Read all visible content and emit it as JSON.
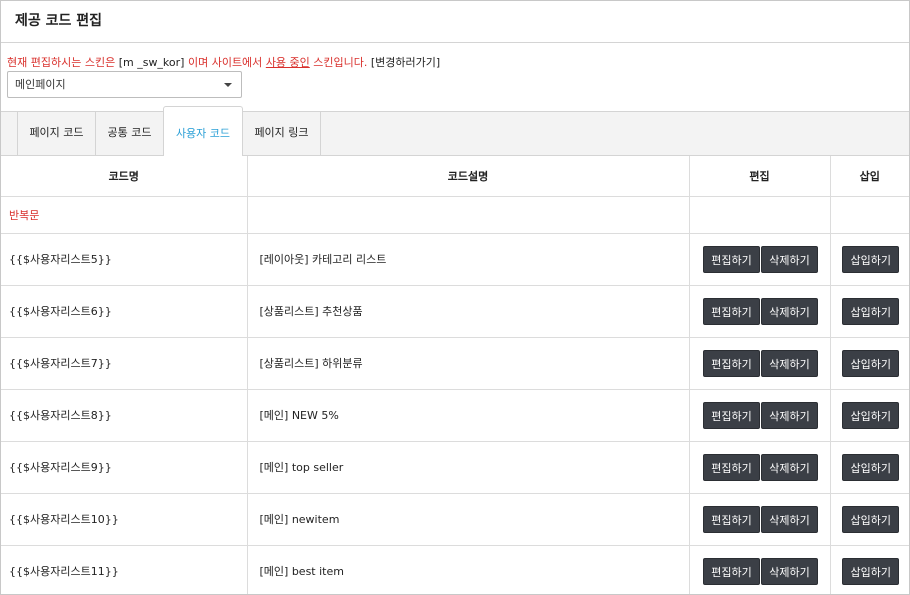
{
  "page": {
    "title": "제공 코드 편집"
  },
  "notice": {
    "prefix": "현재 편집하시는 스킨은 ",
    "skin": "[m _sw_kor]",
    "middle": " 이며 사이트에서 ",
    "link": "사용 중인",
    "suffix": " 스킨입니다. ",
    "change": "[변경하러가기]"
  },
  "selector": {
    "value": "메인페이지"
  },
  "tabs": [
    {
      "label": "페이지 코드",
      "active": false
    },
    {
      "label": "공통 코드",
      "active": false
    },
    {
      "label": "사용자 코드",
      "active": true
    },
    {
      "label": "페이지 링크",
      "active": false
    }
  ],
  "table": {
    "headers": {
      "name": "코드명",
      "desc": "코드설명",
      "edit": "편집",
      "insert": "삽입"
    },
    "group_label": "반복문",
    "buttons": {
      "edit": "편집하기",
      "delete": "삭제하기",
      "insert": "삽입하기"
    },
    "rows": [
      {
        "name": "{{$사용자리스트5}}",
        "desc": "[레이아웃] 카테고리 리스트"
      },
      {
        "name": "{{$사용자리스트6}}",
        "desc": "[상품리스트] 추천상품"
      },
      {
        "name": "{{$사용자리스트7}}",
        "desc": "[상품리스트] 하위분류"
      },
      {
        "name": "{{$사용자리스트8}}",
        "desc": "[메인] NEW 5%"
      },
      {
        "name": "{{$사용자리스트9}}",
        "desc": "[메인] top seller"
      },
      {
        "name": "{{$사용자리스트10}}",
        "desc": "[메인] newitem"
      },
      {
        "name": "{{$사용자리스트11}}",
        "desc": "[메인] best item"
      }
    ]
  },
  "colors": {
    "accent": "#2a9fd6",
    "warning": "#d9302c",
    "button": "#3b3f46"
  }
}
